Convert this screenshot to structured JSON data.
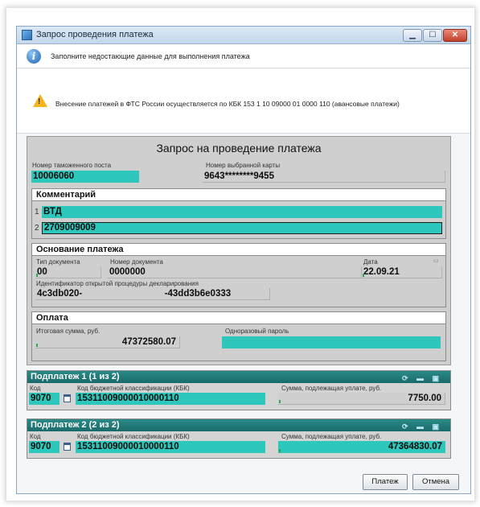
{
  "window": {
    "title": "Запрос проведения платежа"
  },
  "info": {
    "text": "Заполните недостающие данные для выполнения платежа"
  },
  "warning": {
    "text": "Внесение платежей в ФТС России осуществляется по КБК 153 1 10 09000 01 0000 110 (авансовые платежи)"
  },
  "form": {
    "title": "Запрос на проведение платежа",
    "customs_post_label": "Номер таможенного поста",
    "customs_post_value": "10006060",
    "card_label": "Номер выбранной карты",
    "card_value": "9643********9455"
  },
  "comment": {
    "heading": "Комментарий",
    "rows": [
      {
        "num": "1",
        "value": "ВТД"
      },
      {
        "num": "2",
        "value": "2709009009"
      }
    ]
  },
  "basis": {
    "heading": "Основание платежа",
    "doc_type_label": "Тип документа",
    "doc_type_value": "00",
    "doc_number_label": "Номер документа",
    "doc_number_value": "0000000",
    "date_label": "Дата",
    "date_value": "22.09.21",
    "procedure_label": "Идентификатор открытой процедуры декларирования",
    "procedure_value_start": "4c3db020-",
    "procedure_value_end": "-43dd3b6e0333"
  },
  "payment": {
    "heading": "Оплата",
    "total_label": "Итоговая сумма, руб.",
    "total_value": "47372580.07",
    "otp_label": "Одноразовый пароль",
    "otp_value": ""
  },
  "subpayments": [
    {
      "heading": "Подплатеж 1 (1 из 2)",
      "code_label": "Код",
      "code_value": "9070",
      "kbk_label": "Код бюджетной классификации (КБК)",
      "kbk_value": "15311009000010000110",
      "sum_label": "Сумма, подлежащая уплате, руб.",
      "sum_value": "7750.00"
    },
    {
      "heading": "Подплатеж 2 (2 из 2)",
      "code_label": "Код",
      "code_value": "9070",
      "kbk_label": "Код бюджетной классификации (КБК)",
      "kbk_value": "15311009000010000110",
      "sum_label": "Сумма, подлежащая уплате, руб.",
      "sum_value": "47364830.07"
    }
  ],
  "buttons": {
    "pay": "Платеж",
    "cancel": "Отмена"
  },
  "colors": {
    "field_accent": "#2ec7bb",
    "subpayment_header": "#1a6b6a"
  }
}
